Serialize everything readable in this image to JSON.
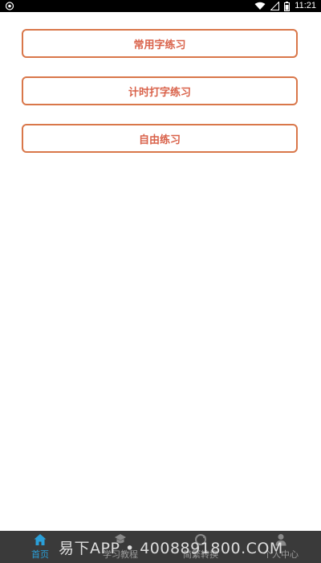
{
  "status_bar": {
    "time": "11:21"
  },
  "menu": {
    "items": [
      {
        "label": "常用字练习"
      },
      {
        "label": "计时打字练习"
      },
      {
        "label": "自由练习"
      }
    ]
  },
  "tab_bar": {
    "tabs": [
      {
        "label": "首页",
        "icon": "home-icon",
        "active": true
      },
      {
        "label": "学习教程",
        "icon": "tutorial-icon",
        "active": false
      },
      {
        "label": "简繁转换",
        "icon": "convert-icon",
        "active": false
      },
      {
        "label": "个人中心",
        "icon": "user-icon",
        "active": false
      }
    ]
  },
  "watermark": {
    "text": "易下APP • 4008891800.COM"
  },
  "colors": {
    "accent": "#d9774a",
    "tab_active": "#2a9fd8",
    "tab_inactive": "#9a9a9a",
    "tab_bar_bg": "#3a3a3a"
  }
}
